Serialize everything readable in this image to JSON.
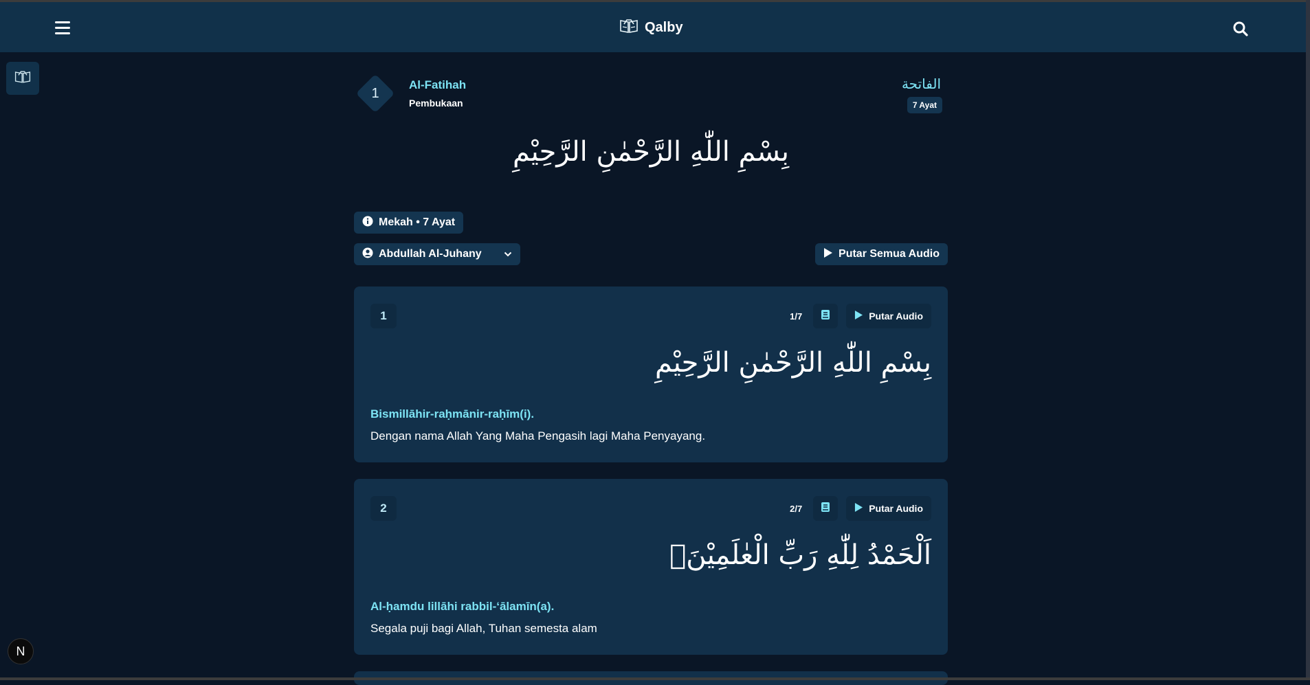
{
  "app": {
    "name": "Qalby"
  },
  "surah": {
    "number": "1",
    "latin_name": "Al-Fatihah",
    "meaning": "Pembukaan",
    "arabic_name": "الفاتحة",
    "ayat_badge": "7 Ayat",
    "bismillah": "بِسْمِ اللّٰهِ الرَّحْمٰنِ الرَّحِيْمِ",
    "info": "Mekah • 7 Ayat"
  },
  "controls": {
    "reciter": "Abdullah Al-Juhany",
    "play_all_label": "Putar Semua Audio"
  },
  "verses": [
    {
      "number": "1",
      "progress": "1/7",
      "play_label": "Putar Audio",
      "arabic": "بِسْمِ اللّٰهِ الرَّحْمٰنِ الرَّحِيْمِ",
      "latin": "Bismillāhir-raḥmānir-raḥīm(i).",
      "translation": "Dengan nama Allah Yang Maha Pengasih lagi Maha Penyayang."
    },
    {
      "number": "2",
      "progress": "2/7",
      "play_label": "Putar Audio",
      "arabic": "اَلْحَمْدُ لِلّٰهِ رَبِّ الْعٰلَمِيْنَۙ",
      "latin": "Al-ḥamdu lillāhi rabbil-‘ālamīn(a).",
      "translation": "Segala puji bagi Allah, Tuhan semesta alam"
    }
  ],
  "dev_badge": "N",
  "colors": {
    "background": "#0a1626",
    "navbar": "#11314a",
    "card": "#12304a",
    "accent": "#7de3f4"
  }
}
